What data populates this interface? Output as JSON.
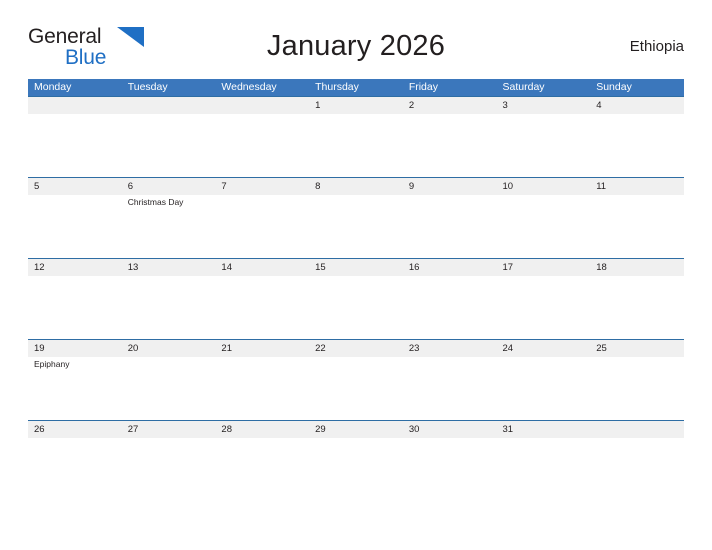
{
  "brand": {
    "name_part1": "General",
    "name_part2": "Blue",
    "flag_icon": "blue-flag-triangle",
    "color_dark": "#231f20",
    "color_blue": "#1f6fc4"
  },
  "header": {
    "title": "January 2026",
    "country": "Ethiopia"
  },
  "calendar": {
    "accent_color": "#3b77bc",
    "date_band_color": "#f0f0f0",
    "rule_color": "#2e6da4",
    "month": "January",
    "year": "2026",
    "weekday_headers": [
      "Monday",
      "Tuesday",
      "Wednesday",
      "Thursday",
      "Friday",
      "Saturday",
      "Sunday"
    ],
    "weeks": [
      {
        "days": [
          {
            "date": "",
            "events": []
          },
          {
            "date": "",
            "events": []
          },
          {
            "date": "",
            "events": []
          },
          {
            "date": "1",
            "events": []
          },
          {
            "date": "2",
            "events": []
          },
          {
            "date": "3",
            "events": []
          },
          {
            "date": "4",
            "events": []
          }
        ]
      },
      {
        "days": [
          {
            "date": "5",
            "events": []
          },
          {
            "date": "6",
            "events": [
              "Christmas Day"
            ]
          },
          {
            "date": "7",
            "events": []
          },
          {
            "date": "8",
            "events": []
          },
          {
            "date": "9",
            "events": []
          },
          {
            "date": "10",
            "events": []
          },
          {
            "date": "11",
            "events": []
          }
        ]
      },
      {
        "days": [
          {
            "date": "12",
            "events": []
          },
          {
            "date": "13",
            "events": []
          },
          {
            "date": "14",
            "events": []
          },
          {
            "date": "15",
            "events": []
          },
          {
            "date": "16",
            "events": []
          },
          {
            "date": "17",
            "events": []
          },
          {
            "date": "18",
            "events": []
          }
        ]
      },
      {
        "days": [
          {
            "date": "19",
            "events": [
              "Epiphany"
            ]
          },
          {
            "date": "20",
            "events": []
          },
          {
            "date": "21",
            "events": []
          },
          {
            "date": "22",
            "events": []
          },
          {
            "date": "23",
            "events": []
          },
          {
            "date": "24",
            "events": []
          },
          {
            "date": "25",
            "events": []
          }
        ]
      },
      {
        "days": [
          {
            "date": "26",
            "events": []
          },
          {
            "date": "27",
            "events": []
          },
          {
            "date": "28",
            "events": []
          },
          {
            "date": "29",
            "events": []
          },
          {
            "date": "30",
            "events": []
          },
          {
            "date": "31",
            "events": []
          },
          {
            "date": "",
            "events": []
          }
        ]
      }
    ]
  }
}
